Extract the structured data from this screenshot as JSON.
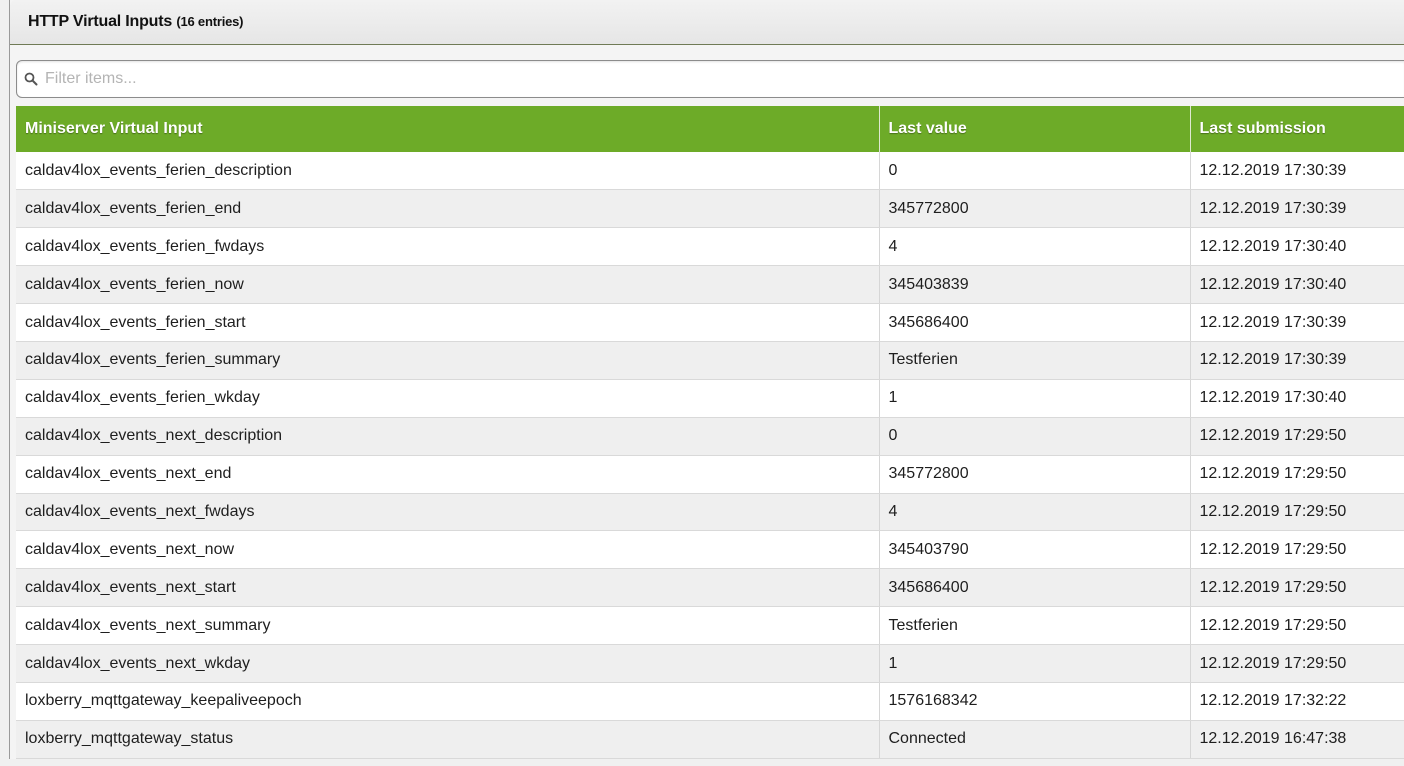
{
  "panel": {
    "title": "HTTP Virtual Inputs",
    "count_label": "(16 entries)"
  },
  "filter": {
    "placeholder": "Filter items...",
    "value": "",
    "icon": "search-icon"
  },
  "table": {
    "columns": [
      "Miniserver Virtual Input",
      "Last value",
      "Last submission"
    ],
    "rows": [
      [
        "caldav4lox_events_ferien_description",
        "0",
        "12.12.2019 17:30:39"
      ],
      [
        "caldav4lox_events_ferien_end",
        "345772800",
        "12.12.2019 17:30:39"
      ],
      [
        "caldav4lox_events_ferien_fwdays",
        "4",
        "12.12.2019 17:30:40"
      ],
      [
        "caldav4lox_events_ferien_now",
        "345403839",
        "12.12.2019 17:30:40"
      ],
      [
        "caldav4lox_events_ferien_start",
        "345686400",
        "12.12.2019 17:30:39"
      ],
      [
        "caldav4lox_events_ferien_summary",
        "Testferien",
        "12.12.2019 17:30:39"
      ],
      [
        "caldav4lox_events_ferien_wkday",
        "1",
        "12.12.2019 17:30:40"
      ],
      [
        "caldav4lox_events_next_description",
        "0",
        "12.12.2019 17:29:50"
      ],
      [
        "caldav4lox_events_next_end",
        "345772800",
        "12.12.2019 17:29:50"
      ],
      [
        "caldav4lox_events_next_fwdays",
        "4",
        "12.12.2019 17:29:50"
      ],
      [
        "caldav4lox_events_next_now",
        "345403790",
        "12.12.2019 17:29:50"
      ],
      [
        "caldav4lox_events_next_start",
        "345686400",
        "12.12.2019 17:29:50"
      ],
      [
        "caldav4lox_events_next_summary",
        "Testferien",
        "12.12.2019 17:29:50"
      ],
      [
        "caldav4lox_events_next_wkday",
        "1",
        "12.12.2019 17:29:50"
      ],
      [
        "loxberry_mqttgateway_keepaliveepoch",
        "1576168342",
        "12.12.2019 17:32:22"
      ],
      [
        "loxberry_mqttgateway_status",
        "Connected",
        "12.12.2019 16:47:38"
      ]
    ]
  },
  "watermark": {
    "icon": "loxberry-logo-icon"
  },
  "colors": {
    "header_green": "#6dab28",
    "row_alt": "#ebebeb"
  }
}
